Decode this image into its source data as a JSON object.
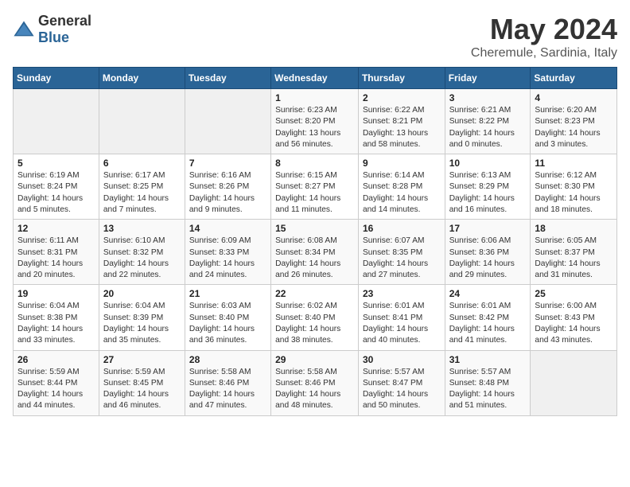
{
  "logo": {
    "text_general": "General",
    "text_blue": "Blue"
  },
  "title": "May 2024",
  "subtitle": "Cheremule, Sardinia, Italy",
  "weekdays": [
    "Sunday",
    "Monday",
    "Tuesday",
    "Wednesday",
    "Thursday",
    "Friday",
    "Saturday"
  ],
  "weeks": [
    [
      {
        "day": "",
        "info": ""
      },
      {
        "day": "",
        "info": ""
      },
      {
        "day": "",
        "info": ""
      },
      {
        "day": "1",
        "info": "Sunrise: 6:23 AM\nSunset: 8:20 PM\nDaylight: 13 hours\nand 56 minutes."
      },
      {
        "day": "2",
        "info": "Sunrise: 6:22 AM\nSunset: 8:21 PM\nDaylight: 13 hours\nand 58 minutes."
      },
      {
        "day": "3",
        "info": "Sunrise: 6:21 AM\nSunset: 8:22 PM\nDaylight: 14 hours\nand 0 minutes."
      },
      {
        "day": "4",
        "info": "Sunrise: 6:20 AM\nSunset: 8:23 PM\nDaylight: 14 hours\nand 3 minutes."
      }
    ],
    [
      {
        "day": "5",
        "info": "Sunrise: 6:19 AM\nSunset: 8:24 PM\nDaylight: 14 hours\nand 5 minutes."
      },
      {
        "day": "6",
        "info": "Sunrise: 6:17 AM\nSunset: 8:25 PM\nDaylight: 14 hours\nand 7 minutes."
      },
      {
        "day": "7",
        "info": "Sunrise: 6:16 AM\nSunset: 8:26 PM\nDaylight: 14 hours\nand 9 minutes."
      },
      {
        "day": "8",
        "info": "Sunrise: 6:15 AM\nSunset: 8:27 PM\nDaylight: 14 hours\nand 11 minutes."
      },
      {
        "day": "9",
        "info": "Sunrise: 6:14 AM\nSunset: 8:28 PM\nDaylight: 14 hours\nand 14 minutes."
      },
      {
        "day": "10",
        "info": "Sunrise: 6:13 AM\nSunset: 8:29 PM\nDaylight: 14 hours\nand 16 minutes."
      },
      {
        "day": "11",
        "info": "Sunrise: 6:12 AM\nSunset: 8:30 PM\nDaylight: 14 hours\nand 18 minutes."
      }
    ],
    [
      {
        "day": "12",
        "info": "Sunrise: 6:11 AM\nSunset: 8:31 PM\nDaylight: 14 hours\nand 20 minutes."
      },
      {
        "day": "13",
        "info": "Sunrise: 6:10 AM\nSunset: 8:32 PM\nDaylight: 14 hours\nand 22 minutes."
      },
      {
        "day": "14",
        "info": "Sunrise: 6:09 AM\nSunset: 8:33 PM\nDaylight: 14 hours\nand 24 minutes."
      },
      {
        "day": "15",
        "info": "Sunrise: 6:08 AM\nSunset: 8:34 PM\nDaylight: 14 hours\nand 26 minutes."
      },
      {
        "day": "16",
        "info": "Sunrise: 6:07 AM\nSunset: 8:35 PM\nDaylight: 14 hours\nand 27 minutes."
      },
      {
        "day": "17",
        "info": "Sunrise: 6:06 AM\nSunset: 8:36 PM\nDaylight: 14 hours\nand 29 minutes."
      },
      {
        "day": "18",
        "info": "Sunrise: 6:05 AM\nSunset: 8:37 PM\nDaylight: 14 hours\nand 31 minutes."
      }
    ],
    [
      {
        "day": "19",
        "info": "Sunrise: 6:04 AM\nSunset: 8:38 PM\nDaylight: 14 hours\nand 33 minutes."
      },
      {
        "day": "20",
        "info": "Sunrise: 6:04 AM\nSunset: 8:39 PM\nDaylight: 14 hours\nand 35 minutes."
      },
      {
        "day": "21",
        "info": "Sunrise: 6:03 AM\nSunset: 8:40 PM\nDaylight: 14 hours\nand 36 minutes."
      },
      {
        "day": "22",
        "info": "Sunrise: 6:02 AM\nSunset: 8:40 PM\nDaylight: 14 hours\nand 38 minutes."
      },
      {
        "day": "23",
        "info": "Sunrise: 6:01 AM\nSunset: 8:41 PM\nDaylight: 14 hours\nand 40 minutes."
      },
      {
        "day": "24",
        "info": "Sunrise: 6:01 AM\nSunset: 8:42 PM\nDaylight: 14 hours\nand 41 minutes."
      },
      {
        "day": "25",
        "info": "Sunrise: 6:00 AM\nSunset: 8:43 PM\nDaylight: 14 hours\nand 43 minutes."
      }
    ],
    [
      {
        "day": "26",
        "info": "Sunrise: 5:59 AM\nSunset: 8:44 PM\nDaylight: 14 hours\nand 44 minutes."
      },
      {
        "day": "27",
        "info": "Sunrise: 5:59 AM\nSunset: 8:45 PM\nDaylight: 14 hours\nand 46 minutes."
      },
      {
        "day": "28",
        "info": "Sunrise: 5:58 AM\nSunset: 8:46 PM\nDaylight: 14 hours\nand 47 minutes."
      },
      {
        "day": "29",
        "info": "Sunrise: 5:58 AM\nSunset: 8:46 PM\nDaylight: 14 hours\nand 48 minutes."
      },
      {
        "day": "30",
        "info": "Sunrise: 5:57 AM\nSunset: 8:47 PM\nDaylight: 14 hours\nand 50 minutes."
      },
      {
        "day": "31",
        "info": "Sunrise: 5:57 AM\nSunset: 8:48 PM\nDaylight: 14 hours\nand 51 minutes."
      },
      {
        "day": "",
        "info": ""
      }
    ]
  ]
}
